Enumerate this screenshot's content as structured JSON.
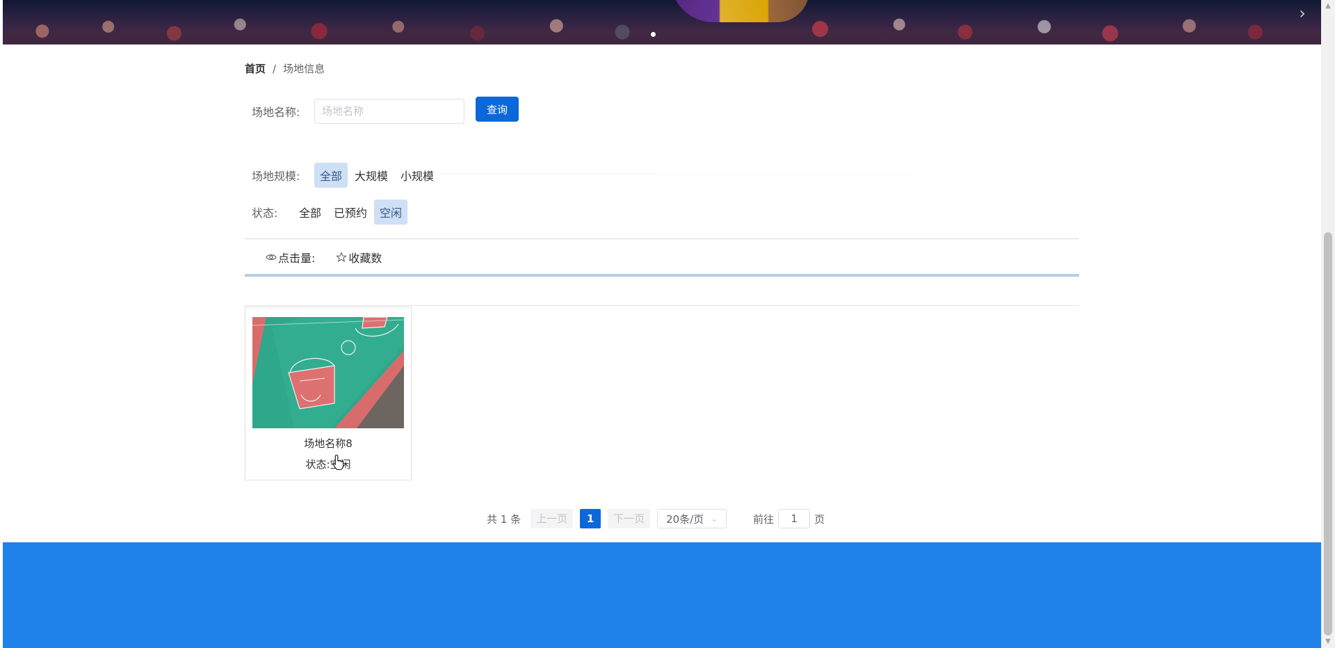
{
  "breadcrumb": {
    "home": "首页",
    "separator": "/",
    "current": "场地信息"
  },
  "search": {
    "label": "场地名称:",
    "placeholder": "场地名称",
    "value": "",
    "button_label": "查询"
  },
  "filters": {
    "scale": {
      "label": "场地规模:",
      "options": [
        "全部",
        "大规模",
        "小规模"
      ],
      "selected": "全部"
    },
    "status": {
      "label": "状态:",
      "options": [
        "全部",
        "已预约",
        "空闲"
      ],
      "selected": "空闲"
    }
  },
  "sort": {
    "clicks_label": "点击量:",
    "favorites_label": "收藏数"
  },
  "venues": [
    {
      "name": "场地名称8",
      "status_text": "状态:空闲"
    }
  ],
  "pagination": {
    "total_text": "共 1 条",
    "prev_label": "上一页",
    "current_page": "1",
    "next_label": "下一页",
    "page_size": "20条/页",
    "goto_prefix": "前往",
    "goto_value": "1",
    "goto_suffix": "页"
  },
  "colors": {
    "primary": "#0c68d8",
    "footer": "#1e82ea",
    "active_filter_bg": "#cfdff5",
    "accent_line": "#b7cde3"
  },
  "icons": {
    "clicks": "eye-icon",
    "favorites": "star-icon",
    "banner_next": "chevron-right-icon",
    "page_size_dropdown": "chevron-down-icon"
  }
}
